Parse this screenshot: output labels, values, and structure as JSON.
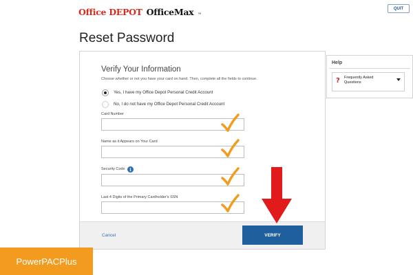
{
  "header": {
    "logo_part1": "Office DEPOT",
    "logo_part2": "OfficeMax",
    "logo_tm": "™",
    "quit_label": "QUIT"
  },
  "page": {
    "title": "Reset Password"
  },
  "form": {
    "section_title": "Verify Your Information",
    "instructions": "Choose whether or not you have your card on hand. Then, complete all the fields to continue.",
    "radio_yes_label": "Yes, I have my Office Depot Personal Credit Account",
    "radio_no_label": "No, I do not have my Office Depot Personal Credit Account",
    "radio_selected": "yes",
    "fields": [
      {
        "label": "Card Number",
        "value": ""
      },
      {
        "label": "Name as it Appears on Your Card",
        "value": ""
      },
      {
        "label": "Security Code",
        "value": ""
      },
      {
        "label": "Last 4 Digits of the Primary Cardholder's SSN",
        "value": ""
      }
    ],
    "info_icon_glyph": "i",
    "cancel_label": "Cancel",
    "verify_label": "VERIFY"
  },
  "help": {
    "title": "Help",
    "faq_label": "Frequently Asked Questions",
    "faq_icon": "?"
  },
  "annotations": {
    "check_icon": "check-mark-icon",
    "check_color": "#f29b1e",
    "arrow_icon": "down-arrow-icon",
    "arrow_color": "#e11b1b"
  },
  "brand_badge": {
    "label": "PowerPACPlus",
    "color": "#f39b1f"
  }
}
